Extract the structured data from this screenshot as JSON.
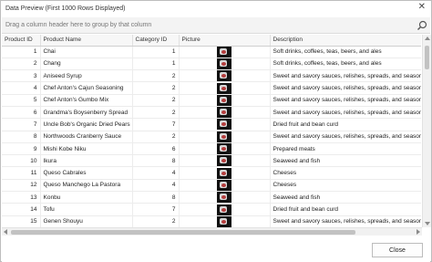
{
  "window": {
    "title": "Data Preview (First 1000 Rows Displayed)"
  },
  "groupbar": {
    "hint": "Drag a column header here to group by that column"
  },
  "columns": [
    "Product ID",
    "Product Name",
    "Category ID",
    "Picture",
    "Description"
  ],
  "rows": [
    {
      "id": "1",
      "name": "Chai",
      "category": "1",
      "description": "Soft drinks, coffees, teas, beers, and ales"
    },
    {
      "id": "2",
      "name": "Chang",
      "category": "1",
      "description": "Soft drinks, coffees, teas, beers, and ales"
    },
    {
      "id": "3",
      "name": "Aniseed Syrup",
      "category": "2",
      "description": "Sweet and savory sauces, relishes, spreads, and seasoning"
    },
    {
      "id": "4",
      "name": "Chef Anton's Cajun Seasoning",
      "category": "2",
      "description": "Sweet and savory sauces, relishes, spreads, and seasoning"
    },
    {
      "id": "5",
      "name": "Chef Anton's Gumbo Mix",
      "category": "2",
      "description": "Sweet and savory sauces, relishes, spreads, and seasoning"
    },
    {
      "id": "6",
      "name": "Grandma's Boysenberry Spread",
      "category": "2",
      "description": "Sweet and savory sauces, relishes, spreads, and seasoning"
    },
    {
      "id": "7",
      "name": "Uncle Bob's Organic Dried Pears",
      "category": "7",
      "description": "Dried fruit and bean curd"
    },
    {
      "id": "8",
      "name": "Northwoods Cranberry Sauce",
      "category": "2",
      "description": "Sweet and savory sauces, relishes, spreads, and seasoning"
    },
    {
      "id": "9",
      "name": "Mishi Kobe Niku",
      "category": "6",
      "description": "Prepared meats"
    },
    {
      "id": "10",
      "name": "Ikura",
      "category": "8",
      "description": "Seaweed and fish"
    },
    {
      "id": "11",
      "name": "Queso Cabrales",
      "category": "4",
      "description": "Cheeses"
    },
    {
      "id": "12",
      "name": "Queso Manchego La Pastora",
      "category": "4",
      "description": "Cheeses"
    },
    {
      "id": "13",
      "name": "Konbu",
      "category": "8",
      "description": "Seaweed and fish"
    },
    {
      "id": "14",
      "name": "Tofu",
      "category": "7",
      "description": "Dried fruit and bean curd"
    },
    {
      "id": "15",
      "name": "Genen Shouyu",
      "category": "2",
      "description": "Sweet and savory sauces, relishes, spreads, and seasoning"
    }
  ],
  "footer": {
    "close_label": "Close"
  },
  "icons": {
    "close": "close-icon",
    "search": "search-icon",
    "picture": "product-thumbnail-icon"
  }
}
